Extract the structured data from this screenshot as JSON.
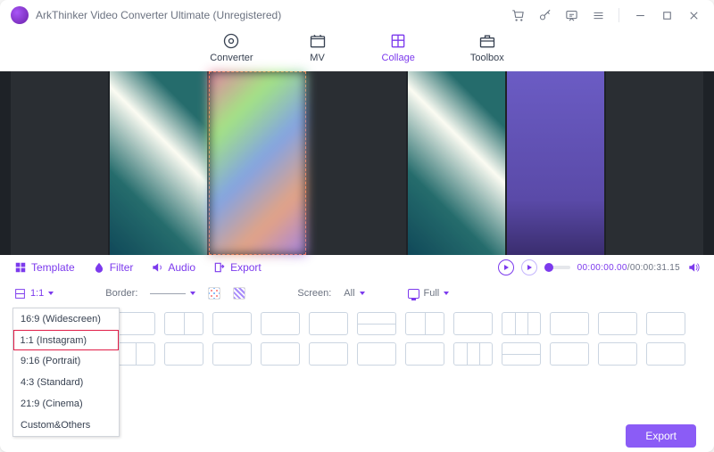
{
  "titlebar": {
    "app_name": "ArkThinker Video Converter Ultimate",
    "reg_state": "(Unregistered)"
  },
  "tabs": {
    "converter": "Converter",
    "mv": "MV",
    "collage": "Collage",
    "toolbox": "Toolbox",
    "active": "collage"
  },
  "modes": {
    "template": "Template",
    "filter": "Filter",
    "audio": "Audio",
    "export": "Export"
  },
  "playback": {
    "current": "00:00:00.00",
    "total": "00:00:31.15"
  },
  "controls": {
    "ratio_label": "1:1",
    "border_label": "Border:",
    "screen_label": "Screen:",
    "screen_value": "All",
    "display_value": "Full"
  },
  "ratio_options": [
    "16:9 (Widescreen)",
    "1:1 (Instagram)",
    "9:16 (Portrait)",
    "4:3 (Standard)",
    "21:9 (Cinema)",
    "Custom&Others"
  ],
  "ratio_highlight_index": 1,
  "footer": {
    "export": "Export"
  }
}
